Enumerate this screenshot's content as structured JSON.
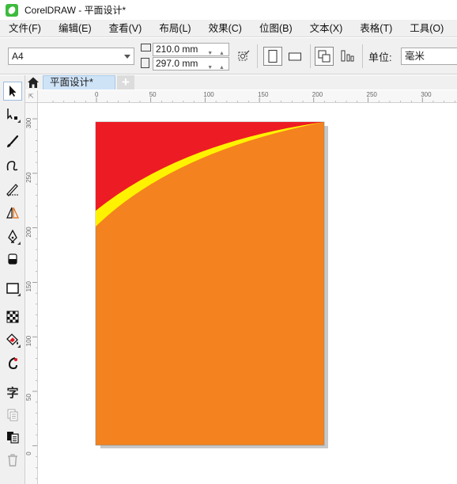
{
  "window": {
    "title": "CorelDRAW - 平面设计*"
  },
  "menu": [
    "文件(F)",
    "编辑(E)",
    "查看(V)",
    "布局(L)",
    "效果(C)",
    "位图(B)",
    "文本(X)",
    "表格(T)",
    "工具(O)"
  ],
  "property_bar": {
    "page_size": "A4",
    "width": "210.0 mm",
    "height": "297.0 mm",
    "unit_label": "单位:",
    "unit_value": "毫米"
  },
  "doc_tabs": {
    "active": "平面设计*",
    "add": "+"
  },
  "ruler": {
    "h_labels": [
      "0",
      "50",
      "100",
      "150",
      "200",
      "250",
      "300"
    ],
    "v_labels": [
      "300",
      "250",
      "200",
      "150",
      "100",
      "50",
      "0"
    ]
  },
  "toolbox": {
    "text_tool_glyph": "字"
  },
  "colors": {
    "page_fill": "#f4821e",
    "swoosh_red": "#ed1c24",
    "swoosh_yellow": "#fff200",
    "shadow": "#c8c8c8",
    "active_tab": "#cfe3f7"
  }
}
